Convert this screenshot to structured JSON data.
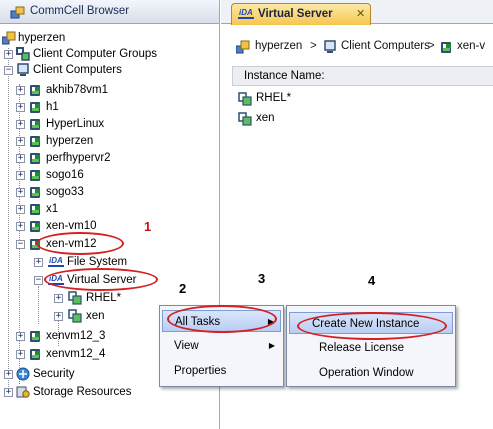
{
  "left_pane": {
    "title": "CommCell Browser",
    "tree": {
      "root": "hyperzen",
      "client_computer_groups": "Client Computer Groups",
      "client_computers": "Client Computers",
      "clients": [
        "akhib78vm1",
        "h1",
        "HyperLinux",
        "hyperzen",
        "perfhypervr2",
        "sogo16",
        "sogo33",
        "x1",
        "xen-vm10",
        "xen-vm12"
      ],
      "xen_vm12_children": {
        "file_system": "File System",
        "virtual_server": "Virtual Server",
        "instances": [
          "RHEL*",
          "xen"
        ]
      },
      "more_clients": [
        "xenvm12_3",
        "xenvm12_4"
      ],
      "security": "Security",
      "storage_resources": "Storage Resources"
    }
  },
  "tab": {
    "icon_text": "iDA",
    "label": "Virtual Server",
    "close": "✕"
  },
  "breadcrumb": {
    "items": [
      "hyperzen",
      "Client Computers",
      "xen-v"
    ],
    "separator": ">"
  },
  "instance_panel": {
    "header": "Instance Name:",
    "rows": [
      "RHEL*",
      "xen"
    ]
  },
  "context_menu": {
    "items": [
      "All Tasks",
      "View",
      "Properties"
    ]
  },
  "submenu": {
    "items": [
      "Create New Instance",
      "Release License",
      "Operation Window"
    ]
  },
  "annotations": {
    "steps": [
      "1",
      "2",
      "3",
      "4"
    ]
  },
  "colors": {
    "annotation_red": "#d42020",
    "tab_gold": "#f5c64e",
    "menu_highlight": "#b8cdf3"
  },
  "icons": {
    "browser": "commcell-icon",
    "client": "client-computer-icon",
    "agent": "ida-agent-icon",
    "security": "security-shield-icon",
    "storage": "storage-icon"
  }
}
